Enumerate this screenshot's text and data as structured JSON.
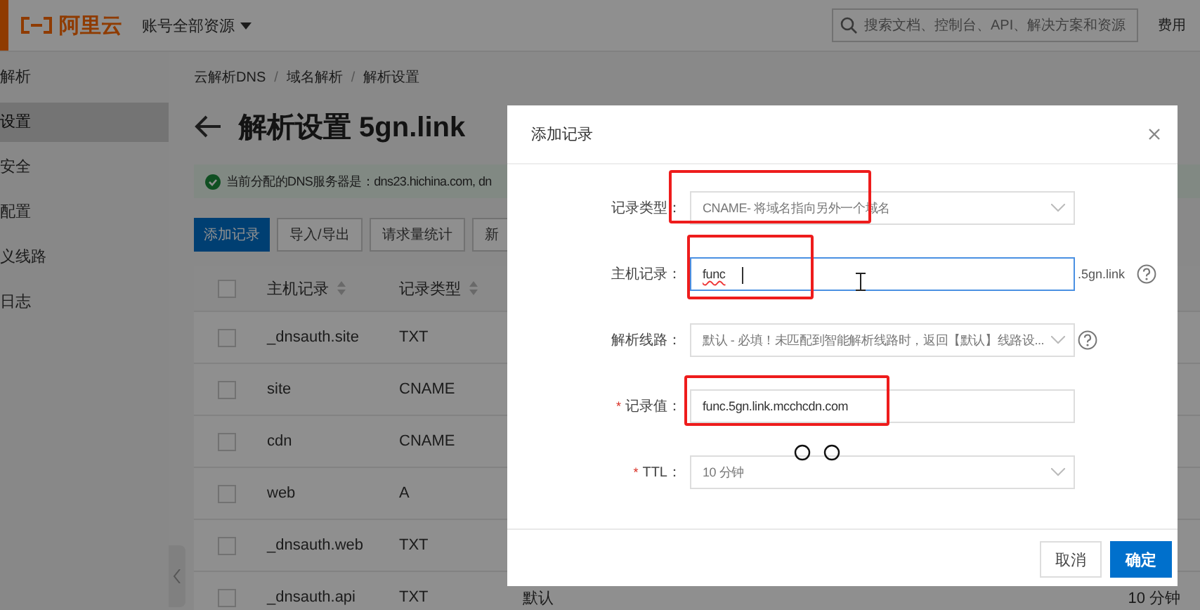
{
  "topbar": {
    "logo": "阿里云",
    "account_menu": "账号全部资源",
    "search": {
      "placeholder": "搜索文档、控制台、API、解决方案和资源"
    },
    "links": [
      "费用"
    ]
  },
  "sidebar": {
    "title": "解析",
    "items": [
      {
        "label": "设置",
        "selected": true
      },
      {
        "label": "安全",
        "selected": false
      },
      {
        "label": "配置",
        "selected": false
      },
      {
        "label": "义线路",
        "selected": false
      },
      {
        "label": "日志",
        "selected": false
      }
    ]
  },
  "breadcrumb": {
    "separator": "/",
    "items": [
      "云解析DNS",
      "域名解析",
      "解析设置"
    ]
  },
  "page_title": "解析设置 5gn.link",
  "notice": "当前分配的DNS服务器是：dns23.hichina.com, dn",
  "toolbar": [
    {
      "label": "添加记录",
      "primary": true
    },
    {
      "label": "导入/导出",
      "primary": false
    },
    {
      "label": "请求量统计",
      "primary": false
    },
    {
      "label": "新",
      "primary": false
    }
  ],
  "table": {
    "all_checked": false,
    "columns": [
      "主机记录",
      "记录类型"
    ],
    "rows": [
      {
        "checked": false,
        "host": "_dnsauth.site",
        "type": "TXT"
      },
      {
        "checked": false,
        "host": "site",
        "type": "CNAME"
      },
      {
        "checked": false,
        "host": "cdn",
        "type": "CNAME"
      },
      {
        "checked": false,
        "host": "web",
        "type": "A"
      },
      {
        "checked": false,
        "host": "_dnsauth.web",
        "type": "TXT"
      },
      {
        "checked": false,
        "host": "_dnsauth.api",
        "type": "TXT",
        "line": "默认",
        "ttl": "10 分钟"
      }
    ]
  },
  "modal": {
    "title": "添加记录",
    "required_mark": "*",
    "fields": [
      {
        "kind": "select",
        "label": "记录类型：",
        "value": "CNAME- 将域名指向另外一个域名",
        "required": false,
        "help": false
      },
      {
        "kind": "input",
        "label": "主机记录：",
        "value": "func",
        "suffix": ".5gn.link",
        "required": false,
        "help": true,
        "focused": true
      },
      {
        "kind": "select",
        "label": "解析线路：",
        "value": "默认 - 必填！未匹配到智能解析线路时，返回【默认】线路设...",
        "required": false,
        "help": true
      },
      {
        "kind": "input",
        "label": "记录值：",
        "value": "func.5gn.link.mcchcdn.com",
        "required": true,
        "help": false,
        "focused": false
      },
      {
        "kind": "select",
        "label": "TTL：",
        "value": "10 分钟",
        "required": true,
        "help": false
      }
    ],
    "buttons": [
      {
        "label": "取消",
        "primary": false
      },
      {
        "label": "确定",
        "primary": true
      }
    ]
  }
}
